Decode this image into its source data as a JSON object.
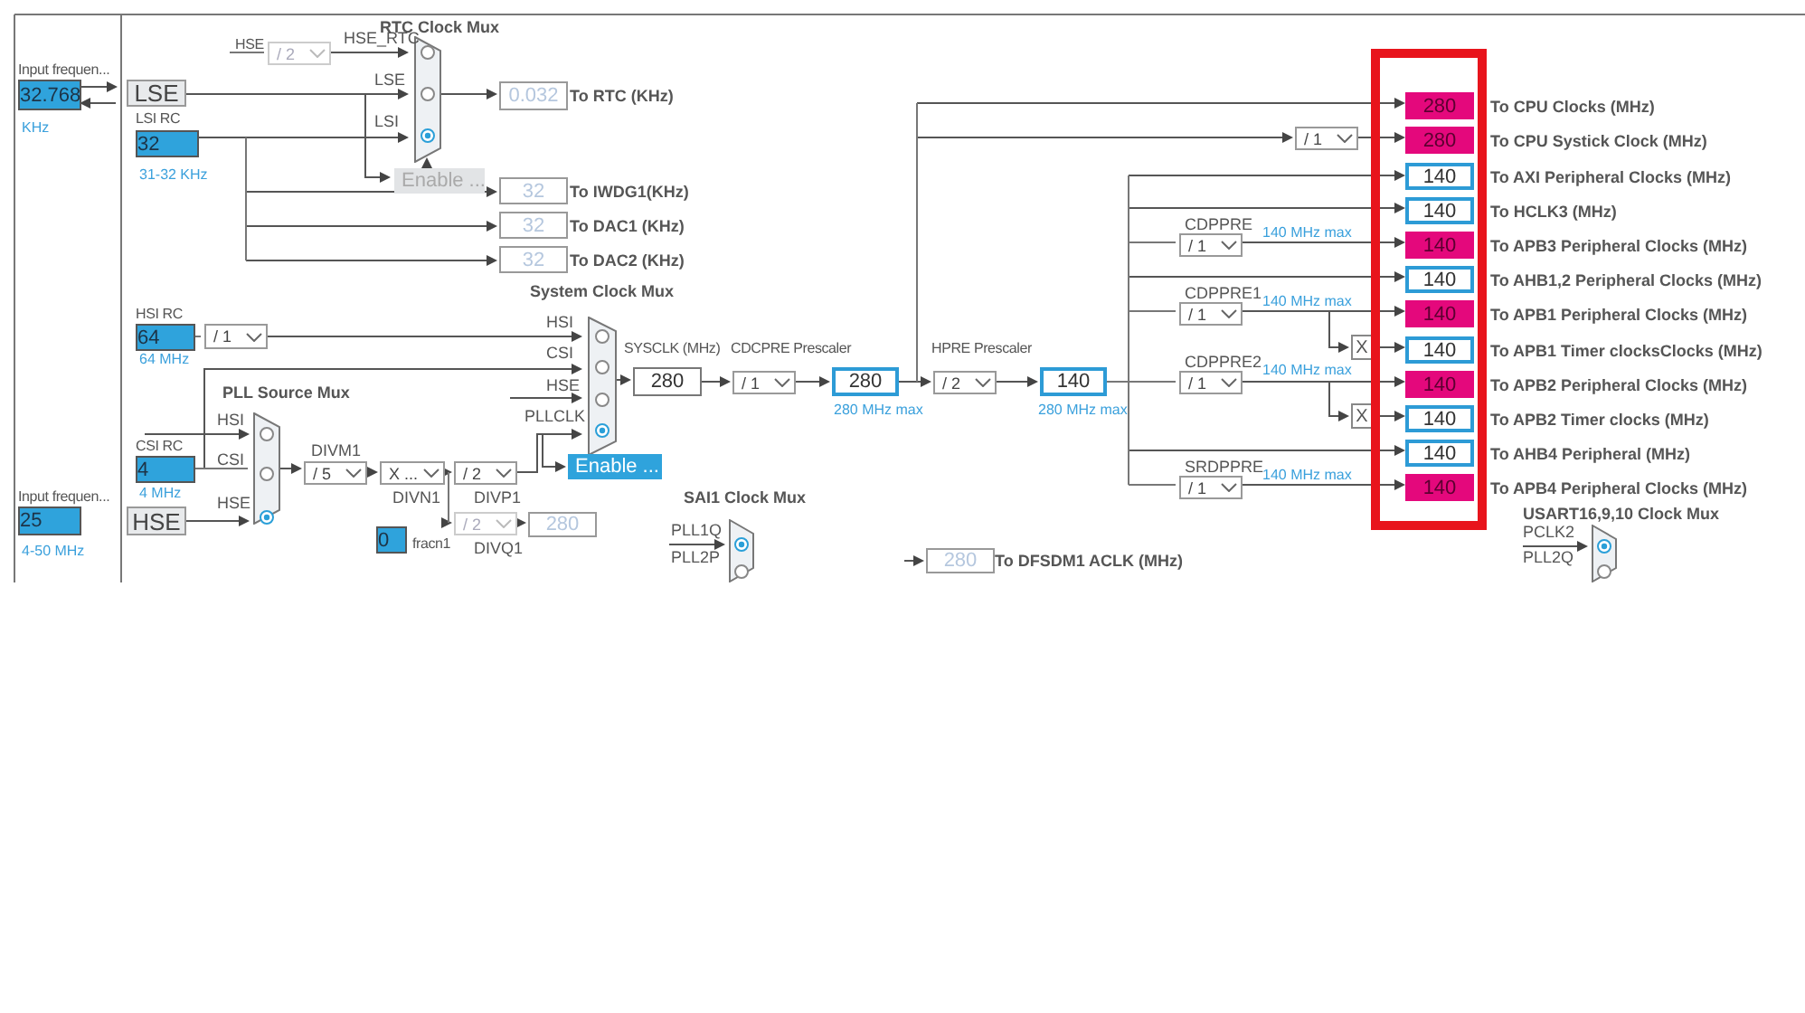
{
  "inputs": [
    {
      "caption": "Input frequen...",
      "value": "32.768",
      "range": "KHz"
    },
    {
      "caption": "LSI RC",
      "value": "32",
      "range": "31-32 KHz"
    },
    {
      "caption": "HSI RC",
      "value": "64",
      "range": "64 MHz"
    },
    {
      "caption": "CSI RC",
      "value": "4",
      "range": "4 MHz"
    },
    {
      "caption": "Input frequen...",
      "value": "25",
      "range": "4-50 MHz"
    },
    {
      "caption": "fracn1",
      "value": "0"
    }
  ],
  "oscillators": [
    "LSE",
    "HSE"
  ],
  "labels": [
    "HSE",
    "SYSCLK (MHz)",
    "CDCPRE Prescaler",
    "HPRE Prescaler"
  ],
  "muxes": [
    {
      "title": "RTC Clock Mux",
      "inputs": [
        {
          "label": "HSE_RTC",
          "selected": false
        },
        {
          "label": "LSE",
          "selected": false
        },
        {
          "label": "LSI",
          "selected": true
        }
      ]
    },
    {
      "title": "System Clock Mux",
      "inputs": [
        {
          "label": "HSI",
          "selected": false
        },
        {
          "label": "CSI",
          "selected": false
        },
        {
          "label": "HSE",
          "selected": false
        },
        {
          "label": "PLLCLK",
          "selected": true
        }
      ]
    },
    {
      "title": "PLL Source Mux",
      "inputs": [
        {
          "label": "HSI",
          "selected": false
        },
        {
          "label": "CSI",
          "selected": false
        },
        {
          "label": "HSE",
          "selected": true
        }
      ]
    },
    {
      "title": "SAI1 Clock Mux",
      "inputs": [
        {
          "label": "PLL1Q",
          "selected": true
        },
        {
          "label": "PLL2P",
          "selected": false
        }
      ]
    },
    {
      "title": "USART16,9,10 Clock Mux",
      "inputs": [
        {
          "label": "PCLK2",
          "selected": true
        },
        {
          "label": "PLL2Q",
          "selected": false
        }
      ]
    }
  ],
  "dividers": [
    {
      "value": "/ 2",
      "disabled": true
    },
    {
      "value": "/ 1",
      "disabled": false
    },
    {
      "value": "/ 5",
      "disabled": false,
      "caption": "DIVM1"
    },
    {
      "value": "X ...",
      "disabled": false,
      "caption": "DIVN1"
    },
    {
      "value": "/ 2",
      "disabled": false,
      "caption": "DIVP1"
    },
    {
      "value": "/ 2",
      "disabled": true,
      "caption": "DIVQ1"
    },
    {
      "value": "/ 1",
      "disabled": false
    },
    {
      "value": "/ 2",
      "disabled": false
    },
    {
      "value": "/ 1",
      "disabled": false
    },
    {
      "value": "/ 1",
      "disabled": false,
      "caption": "CDPPRE",
      "note": "140 MHz max"
    },
    {
      "value": "/ 1",
      "disabled": false,
      "caption": "CDPPRE1",
      "note": "140 MHz max"
    },
    {
      "value": "/ 1",
      "disabled": false,
      "caption": "CDPPRE2",
      "note": "140 MHz max"
    },
    {
      "value": "/ 1",
      "disabled": false,
      "caption": "SRDPPRE",
      "note": "140 MHz max"
    }
  ],
  "enable_buttons": [
    {
      "label": "Enable ...",
      "disabled": true
    },
    {
      "label": "Enable ...",
      "disabled": false
    }
  ],
  "multipliers": [
    "X",
    "X"
  ],
  "outputs": [
    {
      "value": "0.032",
      "kind": "inactive",
      "label": "To RTC (KHz)"
    },
    {
      "value": "32",
      "kind": "inactive",
      "label": "To IWDG1(KHz)"
    },
    {
      "value": "32",
      "kind": "inactive",
      "label": "To DAC1 (KHz)"
    },
    {
      "value": "32",
      "kind": "inactive",
      "label": "To DAC2 (KHz)"
    },
    {
      "value": "280",
      "kind": "inactive"
    },
    {
      "value": "280",
      "kind": "plain"
    },
    {
      "value": "280",
      "kind": "active",
      "note": "280 MHz max"
    },
    {
      "value": "140",
      "kind": "active",
      "note": "280 MHz max"
    },
    {
      "value": "280",
      "kind": "inactive",
      "label": "To DFSDM1 ACLK (MHz)"
    },
    {
      "value": "280",
      "kind": "highlighted",
      "label": "To CPU Clocks (MHz)"
    },
    {
      "value": "280",
      "kind": "highlighted",
      "label": "To CPU Systick Clock (MHz)"
    },
    {
      "value": "140",
      "kind": "active",
      "label": "To AXI Peripheral Clocks (MHz)"
    },
    {
      "value": "140",
      "kind": "active",
      "label": "To HCLK3 (MHz)"
    },
    {
      "value": "140",
      "kind": "highlighted",
      "label": "To APB3 Peripheral Clocks (MHz)"
    },
    {
      "value": "140",
      "kind": "active",
      "label": "To AHB1,2 Peripheral Clocks (MHz)"
    },
    {
      "value": "140",
      "kind": "highlighted",
      "label": "To APB1 Peripheral Clocks (MHz)"
    },
    {
      "value": "140",
      "kind": "active",
      "label": "To APB1 Timer clocksClocks (MHz)"
    },
    {
      "value": "140",
      "kind": "highlighted",
      "label": "To APB2 Peripheral Clocks (MHz)"
    },
    {
      "value": "140",
      "kind": "active",
      "label": "To APB2 Timer clocks (MHz)"
    },
    {
      "value": "140",
      "kind": "active",
      "label": "To AHB4 Peripheral (MHz)"
    },
    {
      "value": "140",
      "kind": "highlighted",
      "label": "To APB4 Peripheral Clocks (MHz)"
    }
  ],
  "annotation": {
    "kind": "highlight_box"
  }
}
